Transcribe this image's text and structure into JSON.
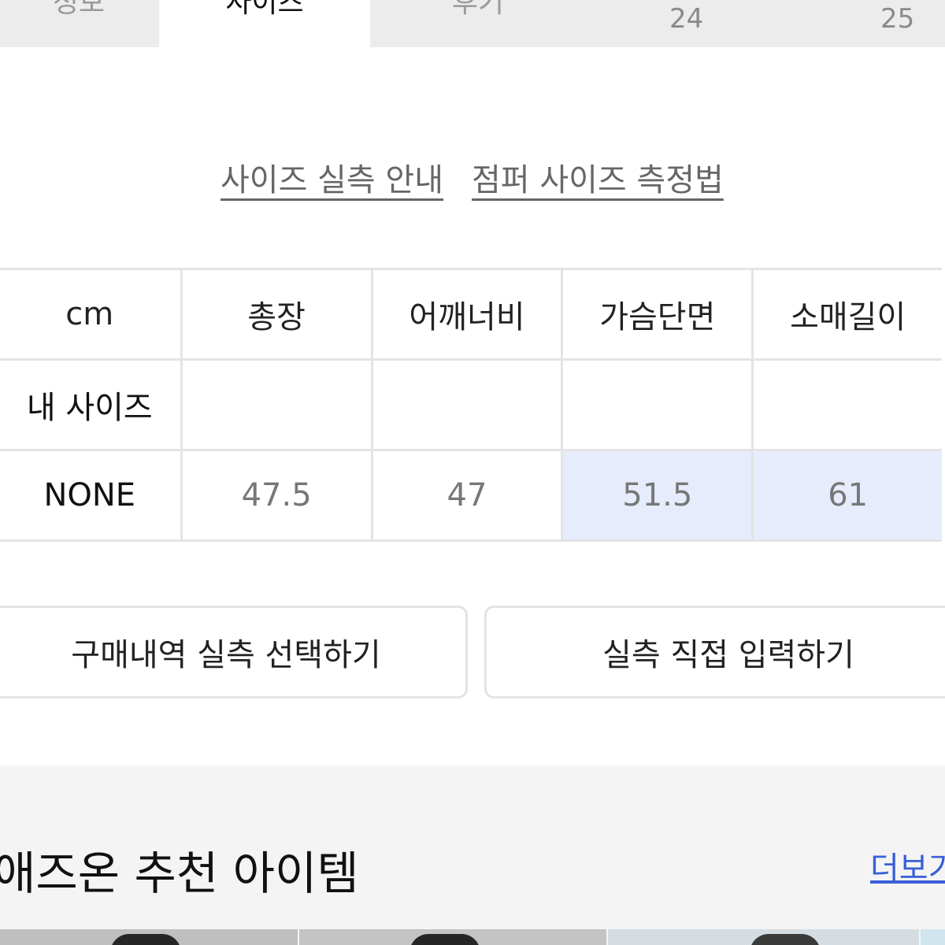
{
  "tabs": {
    "items": [
      {
        "label": "정보"
      },
      {
        "label": "사이즈",
        "active": true
      },
      {
        "label": "후기"
      }
    ],
    "counts": [
      "24",
      "25"
    ]
  },
  "links": {
    "size_guide": "사이즈 실측 안내",
    "measure_guide": "점퍼 사이즈 측정법"
  },
  "size_table": {
    "headers": [
      "cm",
      "총장",
      "어깨너비",
      "가슴단면",
      "소매길이"
    ],
    "my_size_label": "내 사이즈",
    "rows": [
      {
        "label": "NONE",
        "values": [
          "47.5",
          "47",
          "51.5",
          "61"
        ]
      }
    ],
    "highlight_color": "#e7ecfd"
  },
  "buttons": {
    "select_from_purchase": "구매내역 실측 선택하기",
    "enter_manually": "실측 직접 입력하기"
  },
  "recommendations": {
    "title": "애즈온 추천 아이템",
    "more_label": "더보기"
  },
  "colors": {
    "link_blue": "#3a5fd6",
    "border": "#e4e4e4"
  }
}
